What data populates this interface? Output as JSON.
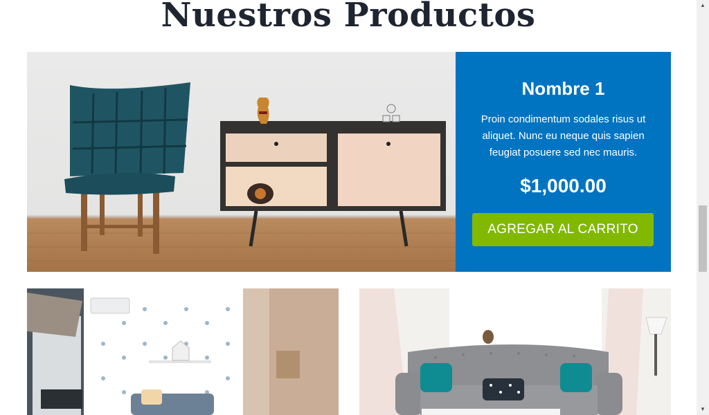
{
  "section_title": "Nuestros Productos",
  "featured_product": {
    "name": "Nombre 1",
    "description": "Proin condimentum sodales risus ut aliquet. Nunc eu neque quis sapien feugiat posuere sed nec mauris.",
    "price": "$1,000.00",
    "button_label": "AGREGAR AL CARRITO"
  },
  "colors": {
    "info_panel": "#0074c1",
    "button": "#81b900",
    "title": "#1e2430"
  },
  "icons": {
    "scroll_up": "▲",
    "scroll_down": "▼"
  }
}
